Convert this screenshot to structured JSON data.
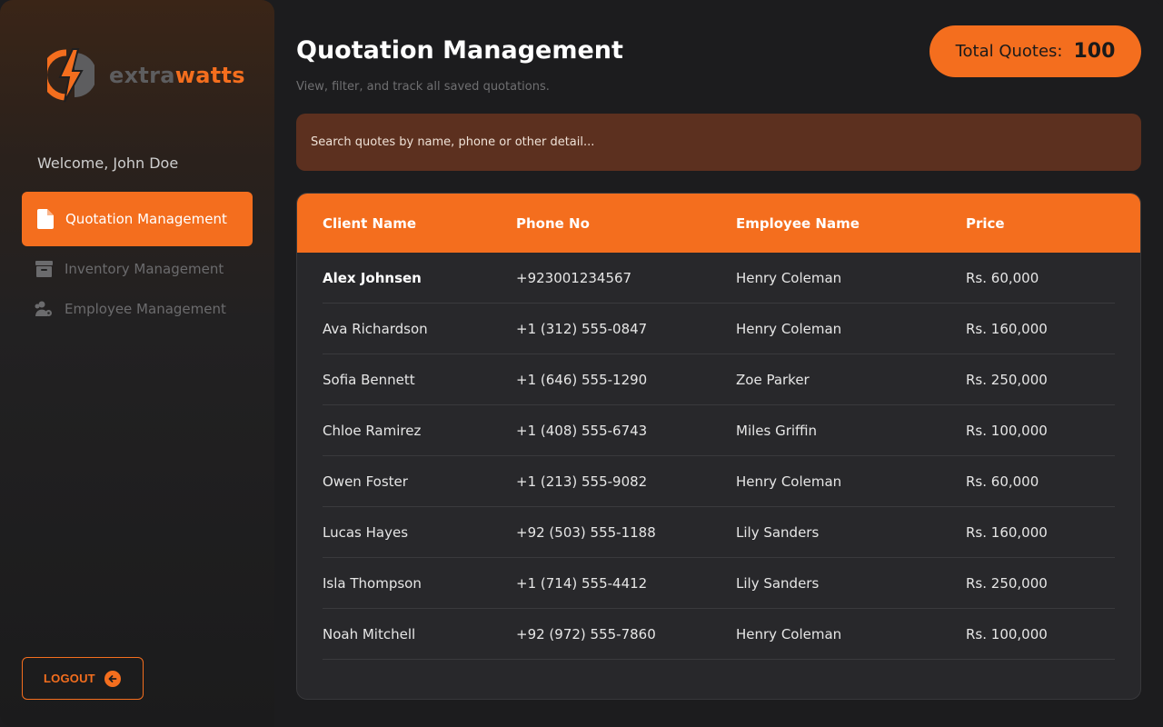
{
  "brand": {
    "name_part1": "extra",
    "name_part2": "watts",
    "accent": "#f46e1e"
  },
  "sidebar": {
    "welcome": "Welcome, John Doe",
    "items": [
      {
        "label": "Quotation Management",
        "icon": "document-icon",
        "active": true
      },
      {
        "label": "Inventory Management",
        "icon": "archive-box-icon",
        "active": false
      },
      {
        "label": "Employee Management",
        "icon": "users-gear-icon",
        "active": false
      }
    ],
    "logout_label": "LOGOUT"
  },
  "main": {
    "title": "Quotation Management",
    "subtitle": "View, filter, and track all saved quotations.",
    "total_label": "Total Quotes:",
    "total_value": "100",
    "search_placeholder": "Search quotes by name, phone or other detail..."
  },
  "table": {
    "headers": [
      "Client Name",
      "Phone No",
      "Employee Name",
      "Price"
    ],
    "rows": [
      [
        "Alex Johnsen",
        "+923001234567",
        "Henry Coleman",
        "Rs. 60,000"
      ],
      [
        "Ava Richardson",
        "+1 (312) 555-0847",
        "Henry Coleman",
        "Rs. 160,000"
      ],
      [
        "Sofia Bennett",
        "+1 (646) 555-1290",
        "Zoe Parker",
        "Rs. 250,000"
      ],
      [
        "Chloe Ramirez",
        "+1 (408) 555-6743",
        "Miles Griffin",
        "Rs. 100,000"
      ],
      [
        "Owen Foster",
        "+1 (213) 555-9082",
        "Henry Coleman",
        "Rs. 60,000"
      ],
      [
        "Lucas Hayes",
        "+92 (503) 555-1188",
        "Lily Sanders",
        "Rs. 160,000"
      ],
      [
        "Isla Thompson",
        "+1 (714) 555-4412",
        "Lily Sanders",
        "Rs. 250,000"
      ],
      [
        "Noah Mitchell",
        "+92 (972) 555-7860",
        "Henry Coleman",
        "Rs. 100,000"
      ]
    ]
  }
}
